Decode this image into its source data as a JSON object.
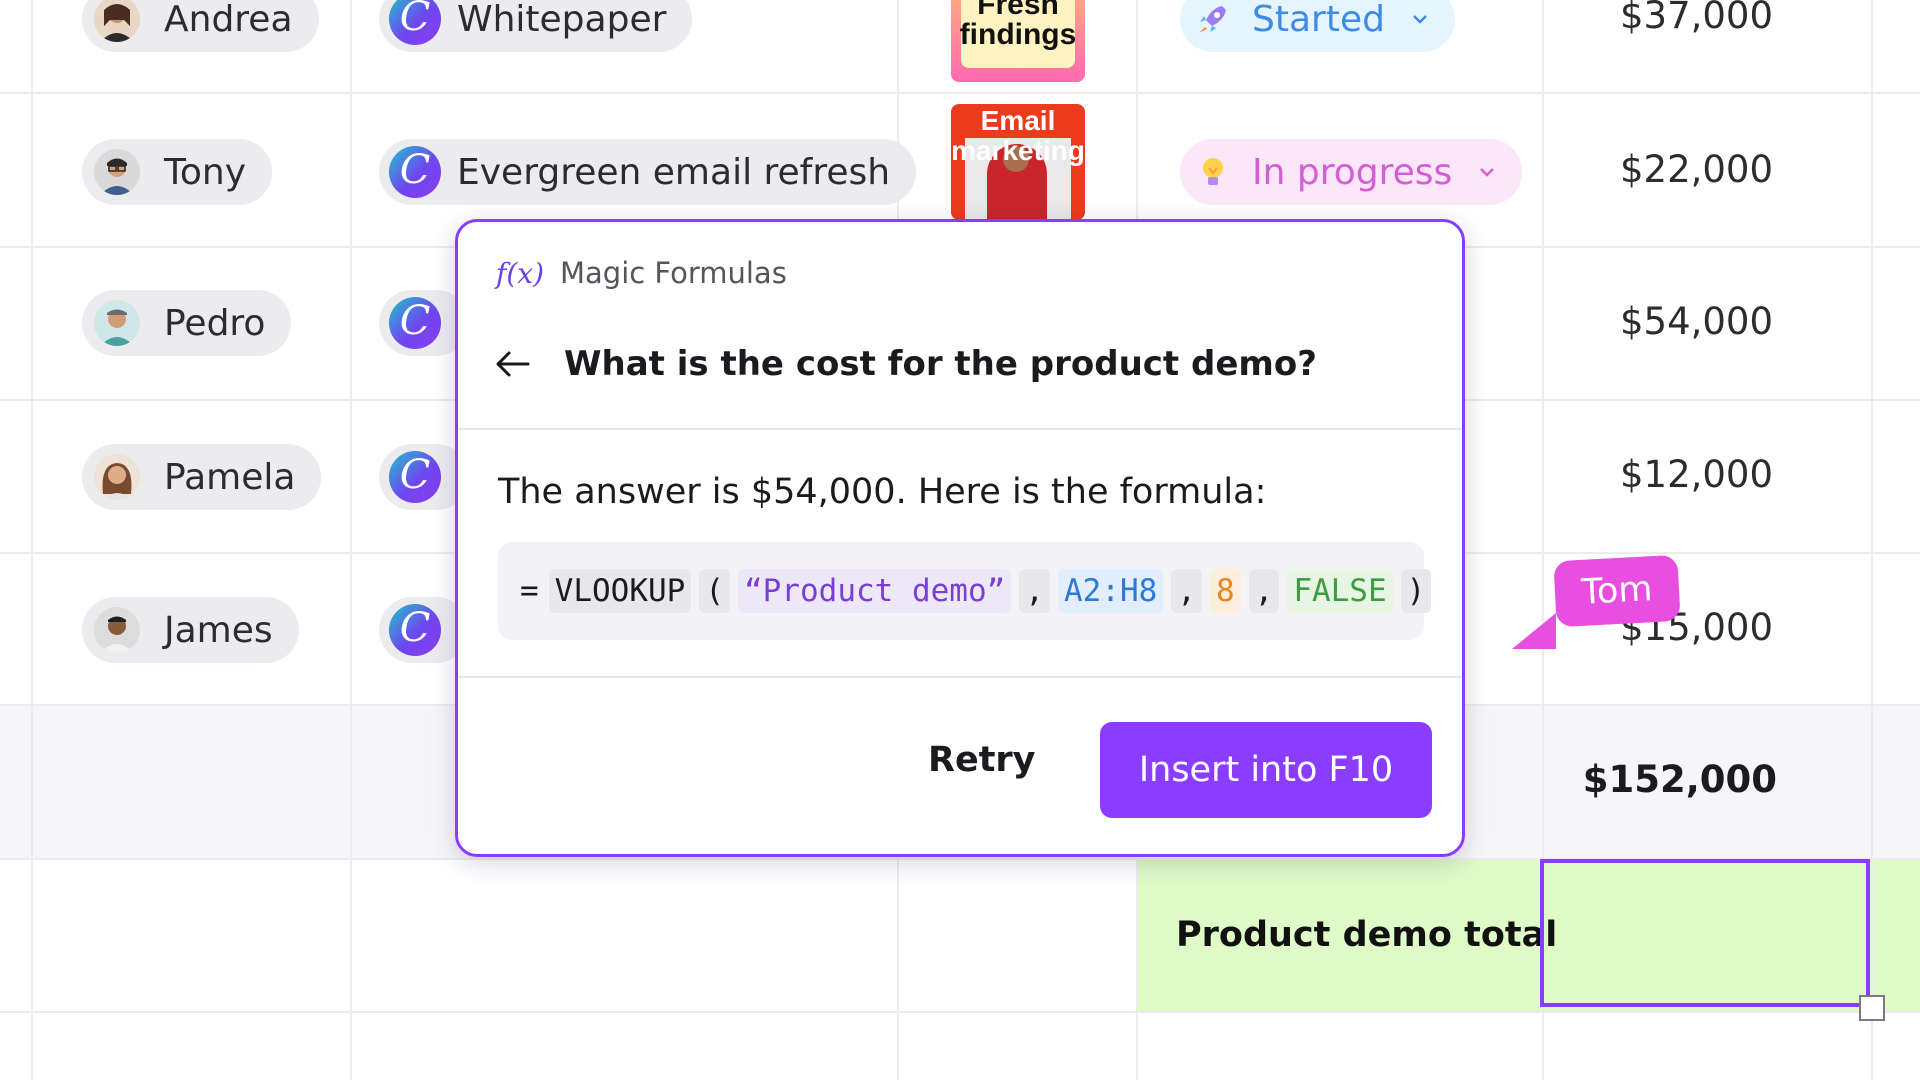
{
  "rows": [
    {
      "person": "Andrea",
      "project": "Whitepaper",
      "thumbnail_text": "Fresh findings",
      "status": "Started",
      "amount": "$37,000"
    },
    {
      "person": "Tony",
      "project": "Evergreen email refresh",
      "thumbnail_text": "Email marketing",
      "status": "In progress",
      "amount": "$22,000"
    },
    {
      "person": "Pedro",
      "amount": "$54,000"
    },
    {
      "person": "Pamela",
      "amount": "$12,000"
    },
    {
      "person": "James",
      "amount": "$15,000"
    }
  ],
  "total": {
    "amount": "$152,000"
  },
  "summary_row": {
    "label": "Product demo total"
  },
  "popup": {
    "fx_symbol": "f(x)",
    "app_title": "Magic Formulas",
    "question": "What is the cost for the product demo?",
    "answer": "The answer is $54,000. Here is the formula:",
    "formula": {
      "eq": "=",
      "function": "VLOOKUP",
      "open_paren": "(",
      "arg1": "“Product demo”",
      "comma1": ",",
      "arg2": "A2:H8",
      "comma2": ",",
      "arg3": "8",
      "comma3": ",",
      "arg4": "FALSE",
      "close_paren": ")"
    },
    "retry_label": "Retry",
    "insert_label": "Insert into F10"
  },
  "collaborator": {
    "name": "Tom",
    "color": "#e84ee0"
  },
  "colors": {
    "accent": "#8b3dff",
    "started_bg": "#e5f4fd",
    "started_text": "#3d8be6",
    "in_progress_bg": "#fbe6fa",
    "in_progress_text": "#d35fd6",
    "highlight_row": "#dffbc8"
  }
}
